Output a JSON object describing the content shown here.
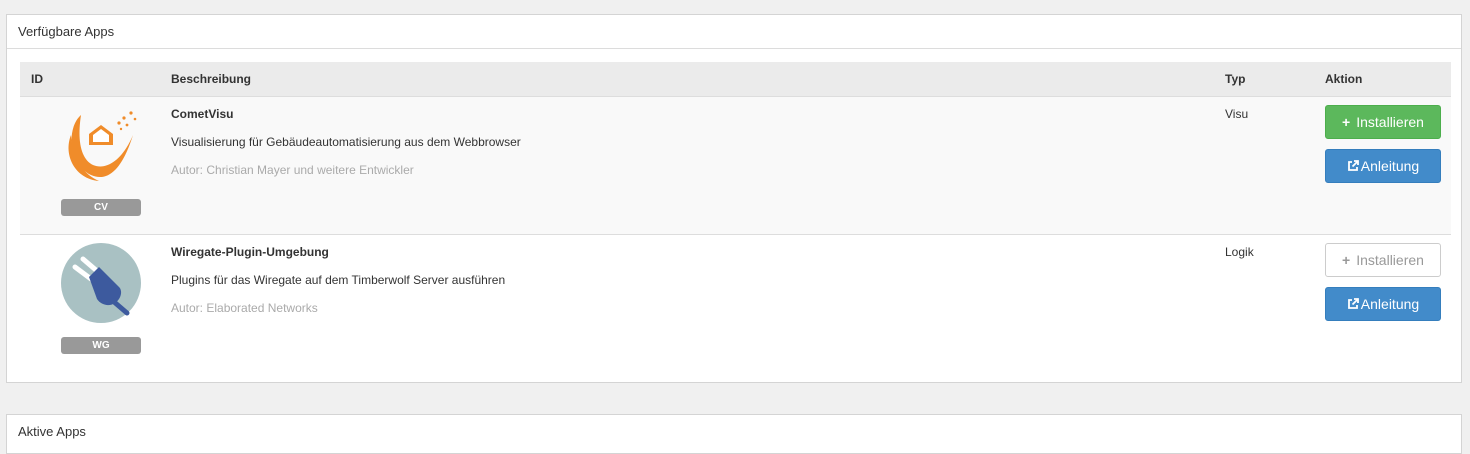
{
  "panels": {
    "available_title": "Verfügbare Apps",
    "active_title": "Aktive Apps"
  },
  "table": {
    "headers": {
      "id": "ID",
      "description": "Beschreibung",
      "type": "Typ",
      "action": "Aktion"
    },
    "rows": [
      {
        "badge": "CV",
        "logo_icon": "cometvisu-logo-icon",
        "name": "CometVisu",
        "description": "Visualisierung für Gebäudeautomatisierung aus dem Webbrowser",
        "author": "Autor: Christian Mayer und weitere Entwickler",
        "type": "Visu",
        "install_label": "Installieren",
        "install_state": "enabled",
        "guide_label": "Anleitung"
      },
      {
        "badge": "WG",
        "logo_icon": "plug-logo-icon",
        "name": "Wiregate-Plugin-Umgebung",
        "description": "Plugins für das Wiregate auf dem Timberwolf Server ausführen",
        "author": "Autor: Elaborated Networks",
        "type": "Logik",
        "install_label": "Installieren",
        "install_state": "disabled",
        "guide_label": "Anleitung"
      }
    ]
  },
  "colors": {
    "success": "#5cb85c",
    "primary": "#428bca",
    "badge": "#999999",
    "cometvisu_orange": "#f08c2a",
    "plug_circle": "#a9c1c3",
    "plug_blue": "#3d5a9e"
  }
}
